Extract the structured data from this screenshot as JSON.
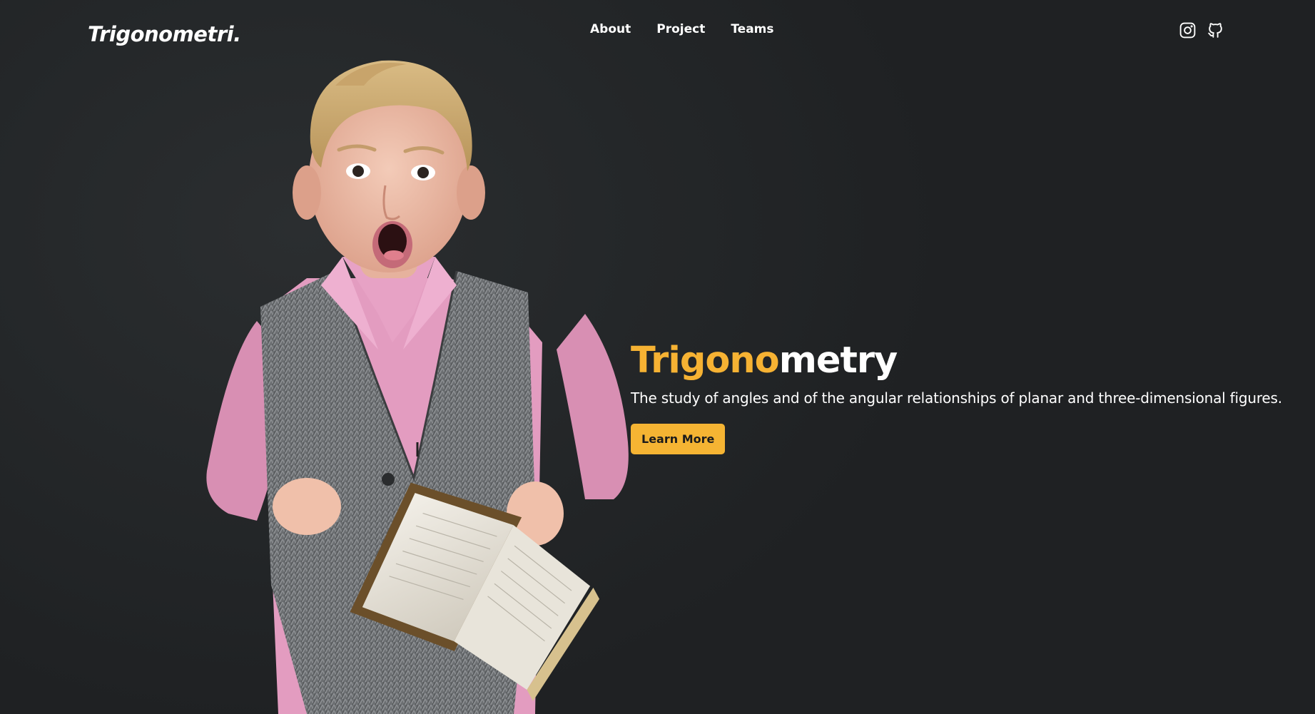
{
  "navbar": {
    "logo": "Trigonometri.",
    "links": [
      {
        "label": "About"
      },
      {
        "label": "Project"
      },
      {
        "label": "Teams"
      }
    ],
    "social": [
      {
        "icon": "instagram-icon"
      },
      {
        "icon": "github-icon"
      }
    ]
  },
  "hero": {
    "title_accent": "Trigono",
    "title_rest": "metry",
    "subtitle": "The study of angles and of the angular relationships of planar and three-dimensional figures.",
    "cta_label": "Learn More",
    "image": "photo of surprised child holding an open book"
  },
  "colors": {
    "background": "#232527",
    "accent": "#f6b233",
    "button": "#f5b433",
    "text": "#ffffff"
  }
}
